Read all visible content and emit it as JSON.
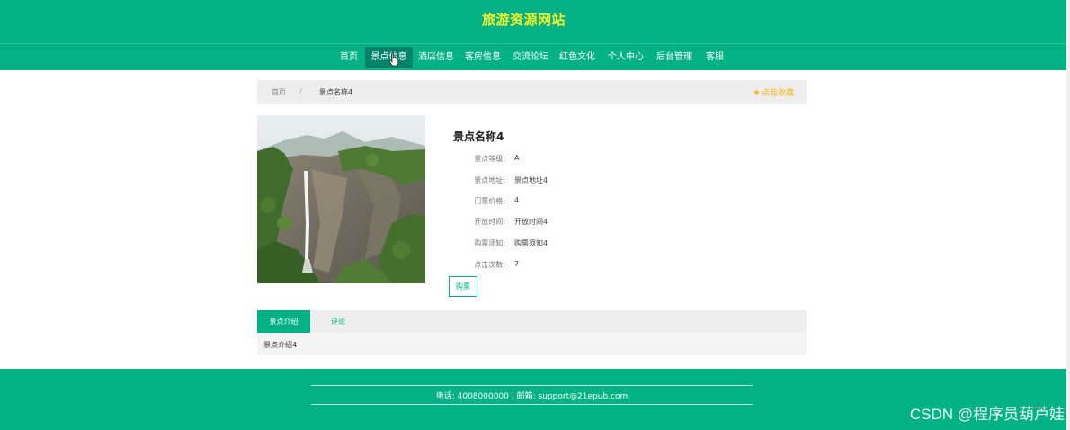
{
  "header": {
    "site_title": "旅游资源网站"
  },
  "nav": {
    "items": [
      {
        "label": "首页"
      },
      {
        "label": "景点信息",
        "active": true
      },
      {
        "label": "酒店信息"
      },
      {
        "label": "客房信息"
      },
      {
        "label": "交流论坛"
      },
      {
        "label": "红色文化"
      },
      {
        "label": "个人中心"
      },
      {
        "label": "后台管理"
      },
      {
        "label": "客服"
      }
    ]
  },
  "breadcrumb": {
    "home": "首页",
    "separator": "/",
    "current": "景点名称4"
  },
  "favorite": {
    "icon": "star-icon",
    "label": "点我收藏"
  },
  "detail": {
    "title": "景点名称4",
    "rows": [
      {
        "label": "景点等级:",
        "value": "A"
      },
      {
        "label": "景点地址:",
        "value": "景点地址4"
      },
      {
        "label": "门票价格:",
        "value": "4"
      },
      {
        "label": "开放时间:",
        "value": "开放时间4"
      },
      {
        "label": "购票须知:",
        "value": "购票须知4"
      },
      {
        "label": "点击次数:",
        "value": "7"
      }
    ],
    "buy_label": "购票"
  },
  "tabs": {
    "items": [
      {
        "label": "景点介绍",
        "active": true
      },
      {
        "label": "评论"
      }
    ],
    "content": "景点介绍4"
  },
  "footer": {
    "contact": "电话: 4008000000 | 邮箱: support@21epub.com"
  },
  "watermark": "CSDN @程序员葫芦娃",
  "colors": {
    "primary": "#02b285",
    "nav_active": "#00836a",
    "title": "#f4f02a",
    "favorite": "#f5b623"
  }
}
